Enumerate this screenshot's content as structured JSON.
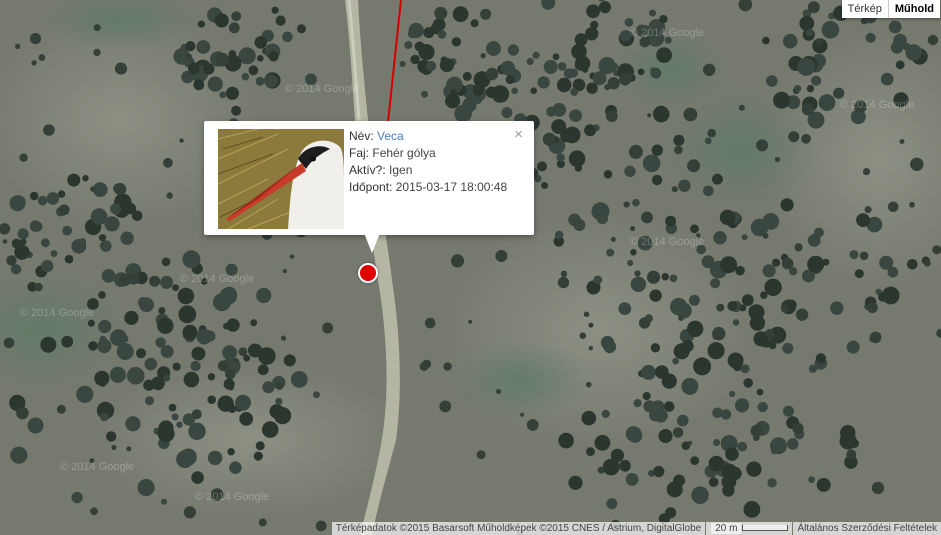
{
  "map_type": {
    "map_label": "Térkép",
    "satellite_label": "Műhold",
    "active": "satellite"
  },
  "popup": {
    "name_label": "Név:",
    "name_value": "Veca",
    "species_label": "Faj:",
    "species_value": "Fehér gólya",
    "active_label": "Aktív?:",
    "active_value": "Igen",
    "time_label": "Időpont:",
    "time_value": "2015-03-17 18:00:48",
    "close_glyph": "×"
  },
  "footer": {
    "attribution": "Térképadatok ©2015 Basarsoft Műholdképek ©2015 CNES / Astrium, DigitalGlobe",
    "scale_label": "20 m",
    "terms": "Általános Szerződési Feltételek"
  },
  "watermark": "© 2014 Google",
  "colors": {
    "marker": "#e10000",
    "track": "#d80000",
    "link": "#4b7fc0"
  }
}
